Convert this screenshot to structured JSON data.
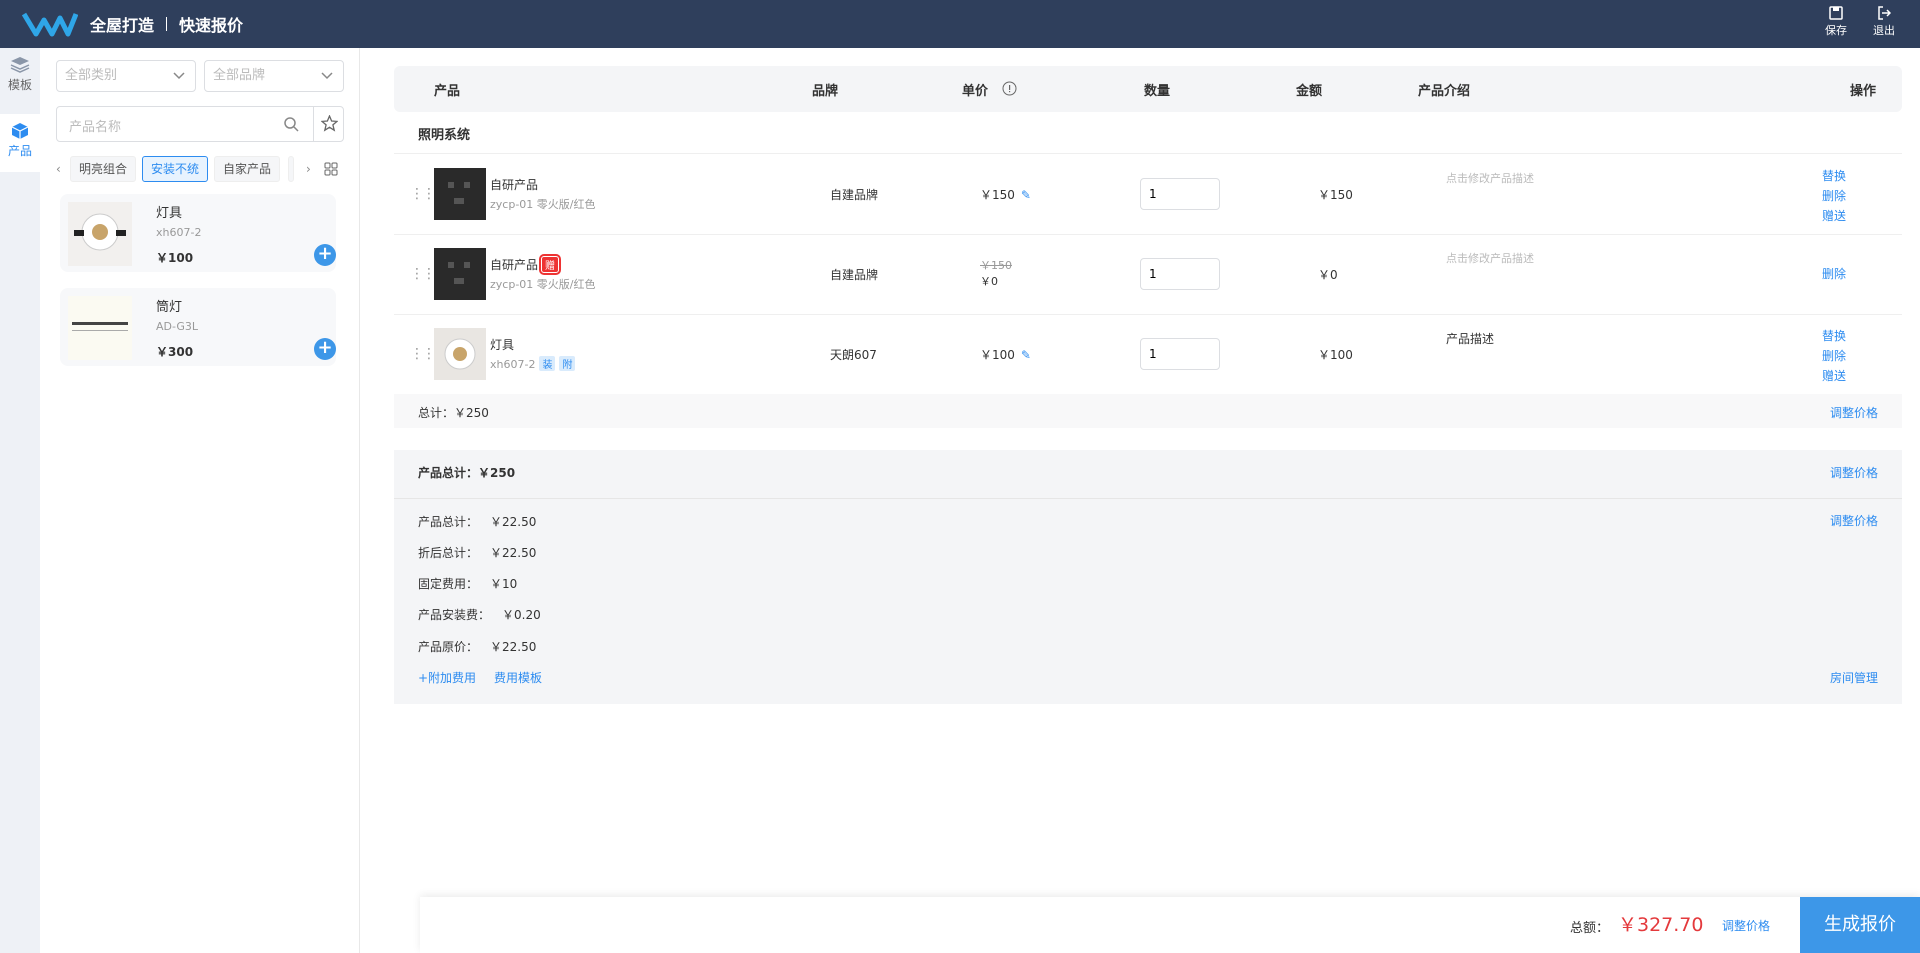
{
  "header": {
    "title": "全屋打造",
    "subtitle": "快速报价",
    "save_label": "保存",
    "exit_label": "退出"
  },
  "leftnav": {
    "items": [
      {
        "label": "模板",
        "icon": "layers-icon"
      },
      {
        "label": "产品",
        "icon": "cube-icon",
        "active": true
      }
    ]
  },
  "filters": {
    "category_placeholder": "全部类别",
    "brand_placeholder": "全部品牌",
    "search_placeholder": "产品名称",
    "chips": [
      "明亮组合",
      "安装不统",
      "自家产品"
    ],
    "active_chip": "安装不统"
  },
  "product_list": [
    {
      "name": "灯具",
      "code": "xh607-2",
      "price": "￥100"
    },
    {
      "name": "筒灯",
      "code": "AD-G3L",
      "price": "￥300"
    }
  ],
  "table": {
    "headers": {
      "product": "产品",
      "brand": "品牌",
      "unit_price": "单价",
      "quantity": "数量",
      "amount": "金额",
      "description": "产品介绍",
      "operation": "操作"
    },
    "group_title": "照明系统",
    "rows": [
      {
        "name": "自研产品",
        "code": "zycp-01 零火版/红色",
        "brand": "自建品牌",
        "price": "￥150",
        "qty": "1",
        "amount": "￥150",
        "desc": "点击修改产品描述",
        "ops": [
          "替换",
          "删除",
          "赠送"
        ]
      },
      {
        "name": "自研产品",
        "tag": "赠",
        "code": "zycp-01 零火版/红色",
        "brand": "自建品牌",
        "orig_price": "￥150",
        "price": "￥0",
        "qty": "1",
        "amount": "￥0",
        "desc": "点击修改产品描述",
        "ops": [
          "删除"
        ]
      },
      {
        "name": "灯具",
        "tags": [
          "装",
          "附"
        ],
        "code": "xh607-2",
        "brand": "天朗607",
        "price": "￥100",
        "qty": "1",
        "amount": "￥100",
        "desc": "产品描述",
        "ops": [
          "替换",
          "删除",
          "赠送"
        ]
      }
    ],
    "subtotal": "总计：￥250",
    "adjust_label": "调整价格"
  },
  "summary": {
    "title": "产品总计：￥250",
    "adjust_label": "调整价格",
    "items": [
      {
        "label": "产品总计：",
        "value": "￥22.50"
      },
      {
        "label": "折后总计：",
        "value": "￥22.50"
      },
      {
        "label": "固定费用：",
        "value": "￥10"
      },
      {
        "label": "产品安装费：",
        "value": "￥0.20"
      },
      {
        "label": "产品原价：",
        "value": "￥22.50"
      }
    ],
    "add_fee": "+附加费用",
    "fee_template": "费用模板",
    "room_manage": "房间管理"
  },
  "footer": {
    "total_label": "总额：",
    "total_value": "￥327.70",
    "adjust_label": "调整价格",
    "generate_label": "生成报价"
  },
  "colors": {
    "header_bg": "#2f3f5c",
    "accent": "#2d8cf0",
    "price_red": "#e4393c"
  }
}
